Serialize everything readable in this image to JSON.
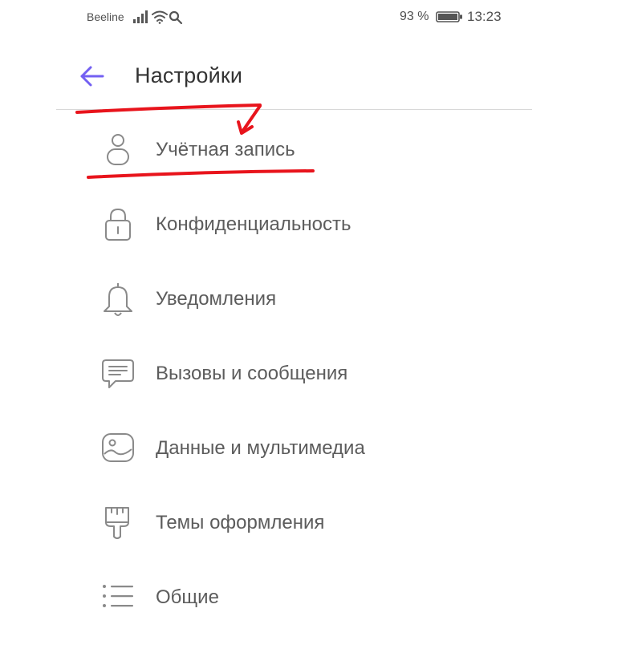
{
  "status_bar": {
    "carrier": "Beeline",
    "battery_percent": "93 %",
    "time": "13:23",
    "icons": [
      "signal-icon",
      "wifi-icon",
      "search-icon",
      "battery-icon"
    ]
  },
  "header": {
    "title": "Настройки",
    "back_icon": "back-arrow-icon"
  },
  "menu": {
    "items": [
      {
        "label": "Учётная запись",
        "icon": "account-icon"
      },
      {
        "label": "Конфиденциальность",
        "icon": "lock-icon"
      },
      {
        "label": "Уведомления",
        "icon": "bell-icon"
      },
      {
        "label": "Вызовы и сообщения",
        "icon": "chat-icon"
      },
      {
        "label": "Данные и мультимедиа",
        "icon": "image-icon"
      },
      {
        "label": "Темы оформления",
        "icon": "brush-icon"
      },
      {
        "label": "Общие",
        "icon": "list-icon"
      }
    ]
  },
  "colors": {
    "accent": "#7360f2",
    "icon": "#8a8a8a",
    "text": "#5c5c5c",
    "title": "#333333",
    "annotation": "#e8141c"
  }
}
